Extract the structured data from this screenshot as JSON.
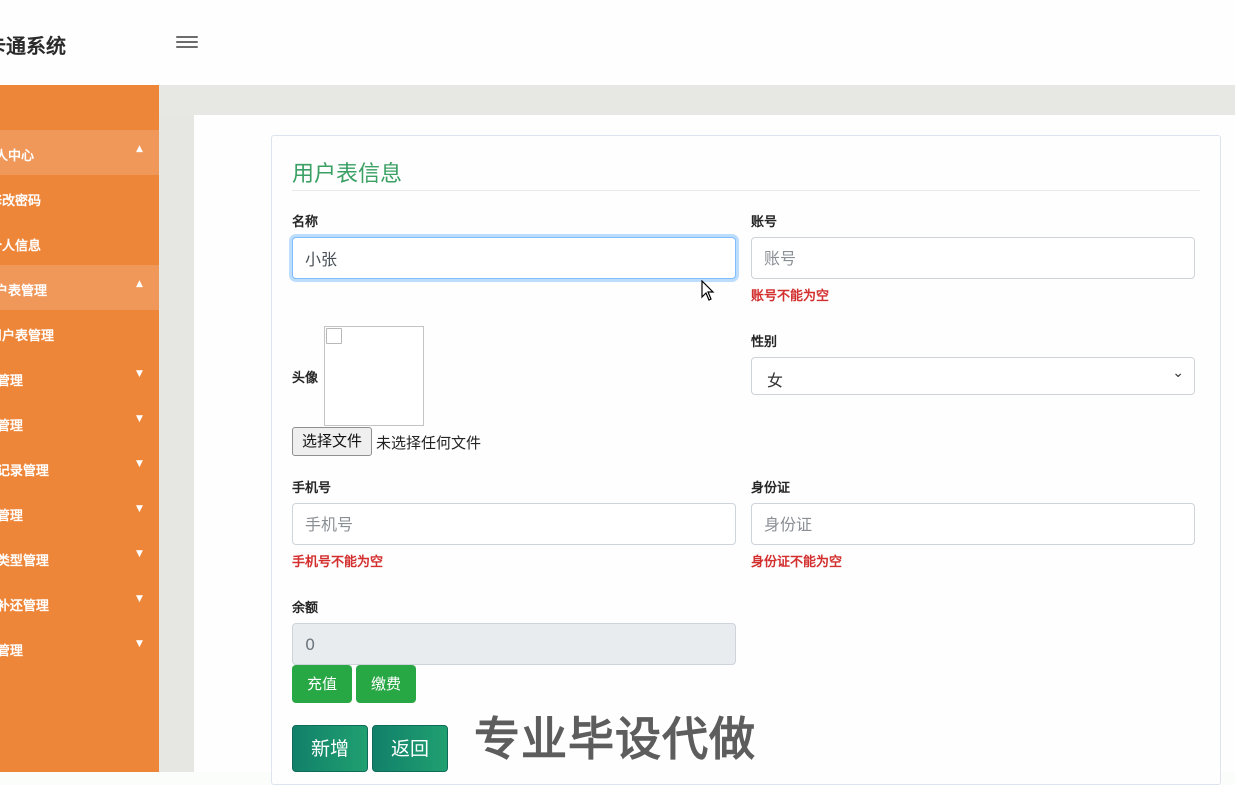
{
  "app": {
    "title": "卡通系统"
  },
  "sidebar": {
    "items": [
      {
        "label": "个人中心",
        "expanded": true
      },
      {
        "label": "修改密码"
      },
      {
        "label": "个人信息"
      },
      {
        "label": "用户表管理",
        "expanded": true
      },
      {
        "label": "用户表管理"
      },
      {
        "label": "...管理"
      },
      {
        "label": "...管理"
      },
      {
        "label": "...记录管理"
      },
      {
        "label": "...管理"
      },
      {
        "label": "...类型管理"
      },
      {
        "label": "...补还管理"
      },
      {
        "label": "...管理"
      }
    ]
  },
  "form": {
    "title": "用户表信息",
    "name": {
      "label": "名称",
      "value": "小张"
    },
    "account": {
      "label": "账号",
      "placeholder": "账号",
      "error": "账号不能为空"
    },
    "avatar": {
      "label": "头像",
      "file_button": "选择文件",
      "file_status": "未选择任何文件"
    },
    "gender": {
      "label": "性别",
      "value": "女"
    },
    "phone": {
      "label": "手机号",
      "placeholder": "手机号",
      "error": "手机号不能为空"
    },
    "idcard": {
      "label": "身份证",
      "placeholder": "身份证",
      "error": "身份证不能为空"
    },
    "balance": {
      "label": "余额",
      "value": "0"
    },
    "recharge_button": "充值",
    "pay_button": "缴费",
    "add_button": "新增",
    "back_button": "返回"
  },
  "watermark": "专业毕设代做",
  "colors": {
    "sidebar": "#ee863a",
    "sidebar_active": "#f0975a",
    "title": "#3aa064",
    "error": "#d32f2f",
    "success": "#28a745",
    "teal": "#12806a"
  },
  "icons": {
    "menu_toggle": "hamburger-icon",
    "caret": "caret-icon",
    "select_chevron": "chevron-down-icon"
  }
}
